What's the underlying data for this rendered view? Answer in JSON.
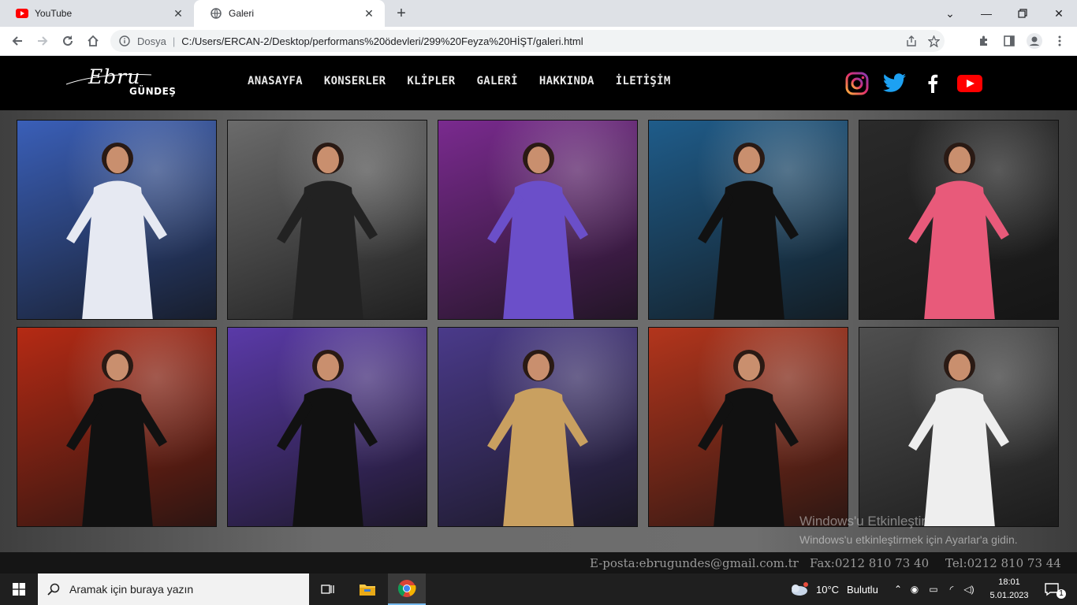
{
  "browser": {
    "tabs": [
      {
        "title": "YouTube",
        "favicon": "youtube-icon",
        "active": false
      },
      {
        "title": "Galeri",
        "favicon": "globe-icon",
        "active": true
      }
    ],
    "address": {
      "scheme_label": "Dosya",
      "url": "C:/Users/ERCAN-2/Desktop/performans%20ödevleri/299%20Feyza%20HİŞT/galeri.html"
    }
  },
  "site": {
    "logo": {
      "script": "Ebru",
      "sub": "GÜNDEŞ"
    },
    "nav": [
      "ANASAYFA",
      "KONSERLER",
      "KLİPLER",
      "GALERİ",
      "HAKKINDA",
      "İLETİŞİM"
    ],
    "social": [
      "instagram-icon",
      "twitter-icon",
      "facebook-icon",
      "youtube-icon"
    ],
    "photos": [
      {
        "alt": "white sequin dress on stage",
        "bg": "#3a5fb8",
        "accent": "#e6e9f2"
      },
      {
        "alt": "black and white singing",
        "bg": "#6b6b6b",
        "accent": "#222"
      },
      {
        "alt": "purple corset on lit stage",
        "bg": "#7a2a8f",
        "accent": "#6b4fc9"
      },
      {
        "alt": "black jumpsuit with light wall",
        "bg": "#1f5c8a",
        "accent": "#111"
      },
      {
        "alt": "pink floral dress with band",
        "bg": "#2a2a2a",
        "accent": "#e85a7a"
      },
      {
        "alt": "red stage black fringe dress",
        "bg": "#b52a14",
        "accent": "#111"
      },
      {
        "alt": "purple lights black suit",
        "bg": "#5a3aa8",
        "accent": "#111"
      },
      {
        "alt": "yellow beams gold dress",
        "bg": "#4a3a8a",
        "accent": "#c9a060"
      },
      {
        "alt": "orange stage pointing up",
        "bg": "#b3351c",
        "accent": "#111"
      },
      {
        "alt": "black and white white dress",
        "bg": "#4f4f4f",
        "accent": "#eeeeee"
      }
    ],
    "watermark": {
      "line1": "Windows'u Etkinleştir",
      "line2": "Windows'u etkinleştirmek için Ayarlar'a gidin."
    },
    "footer": {
      "email": "E-posta:ebrugundes@gmail.com.tr",
      "fax": "Fax:0212 810 73 40",
      "tel": "Tel:0212 810 73 44"
    }
  },
  "taskbar": {
    "search_placeholder": "Aramak için buraya yazın",
    "weather": {
      "temp": "10°C",
      "label": "Bulutlu"
    },
    "time": "18:01",
    "date": "5.01.2023",
    "notification_count": "1"
  }
}
